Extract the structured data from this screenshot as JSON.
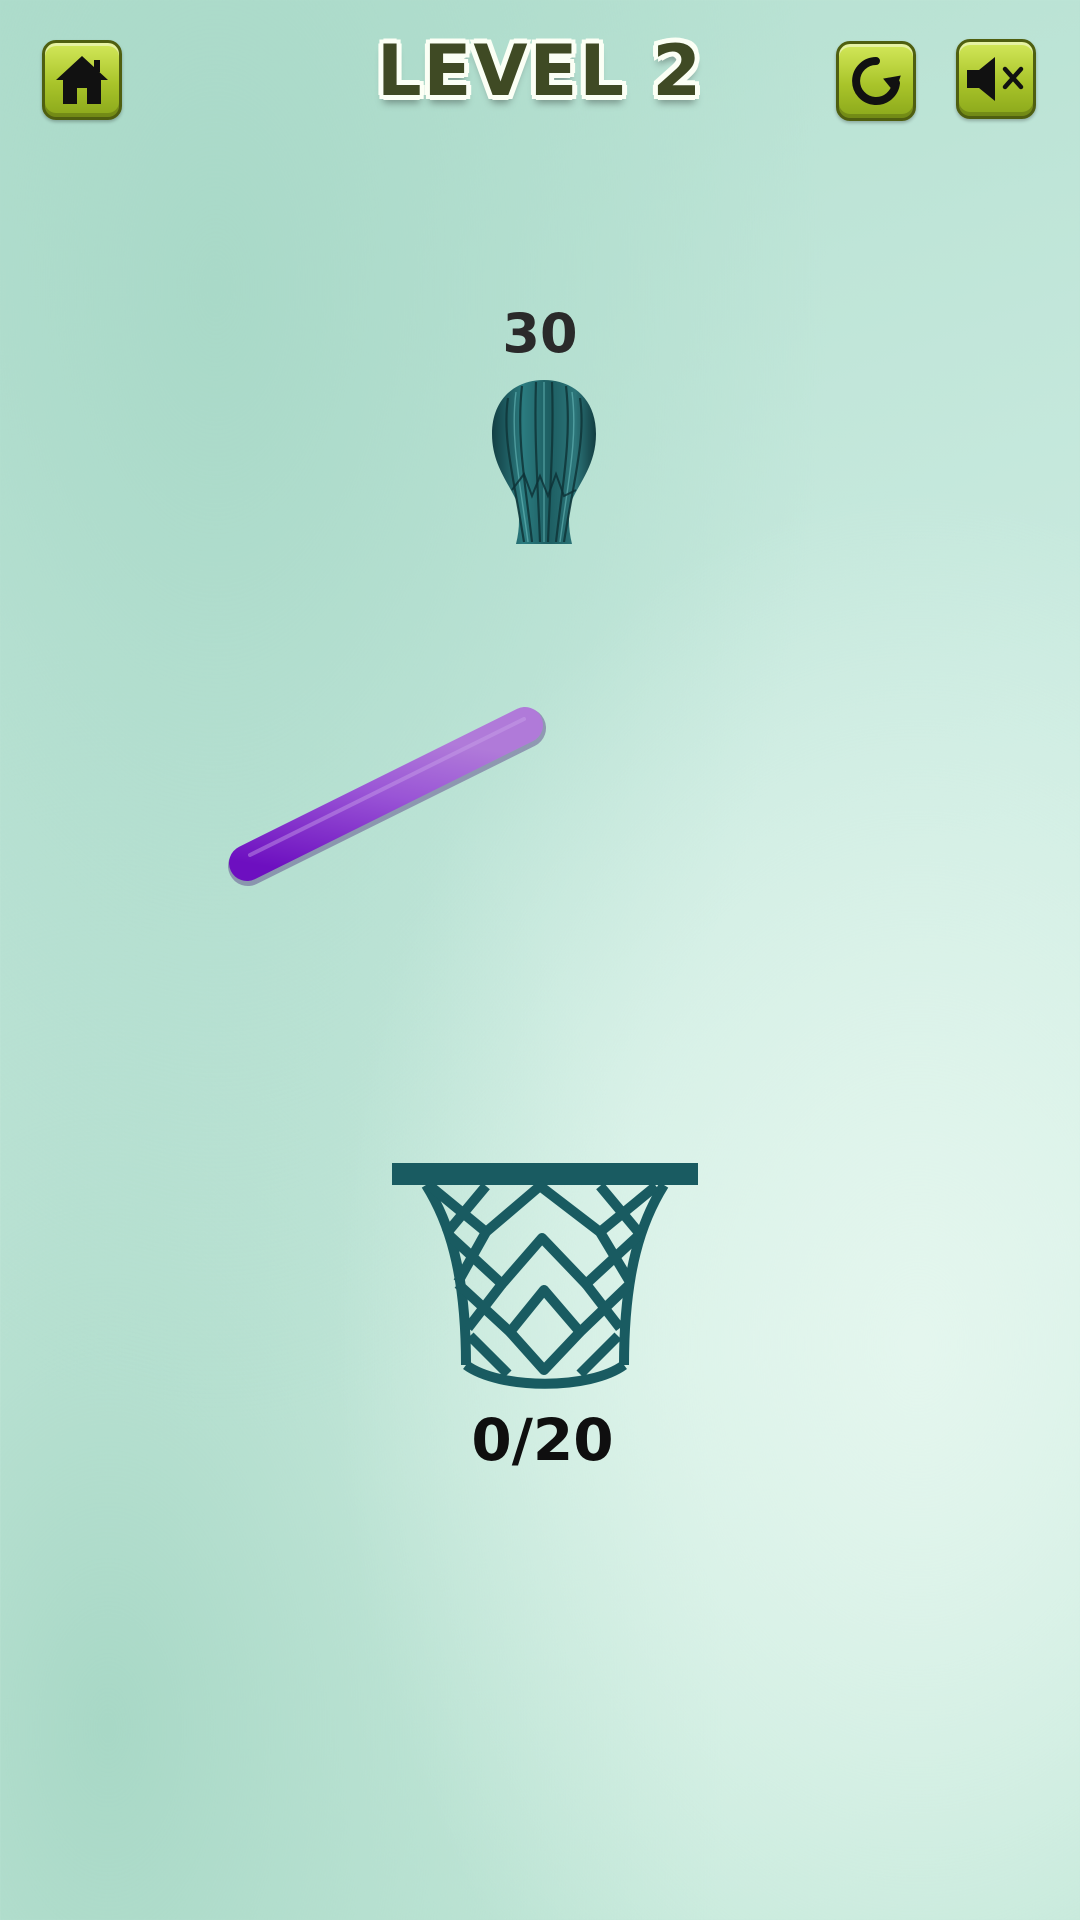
{
  "header": {
    "level_title": "LEVEL 2",
    "home_icon": "home-icon",
    "restart_icon": "restart-icon",
    "sound_icon": "sound-muted-icon",
    "button_color": "#b4cd34"
  },
  "dispenser": {
    "balls_remaining": "30",
    "color": "#1f5f63"
  },
  "ramp": {
    "color": "#8b3fd0"
  },
  "hoop": {
    "score": "0/20",
    "color": "#195b61"
  }
}
